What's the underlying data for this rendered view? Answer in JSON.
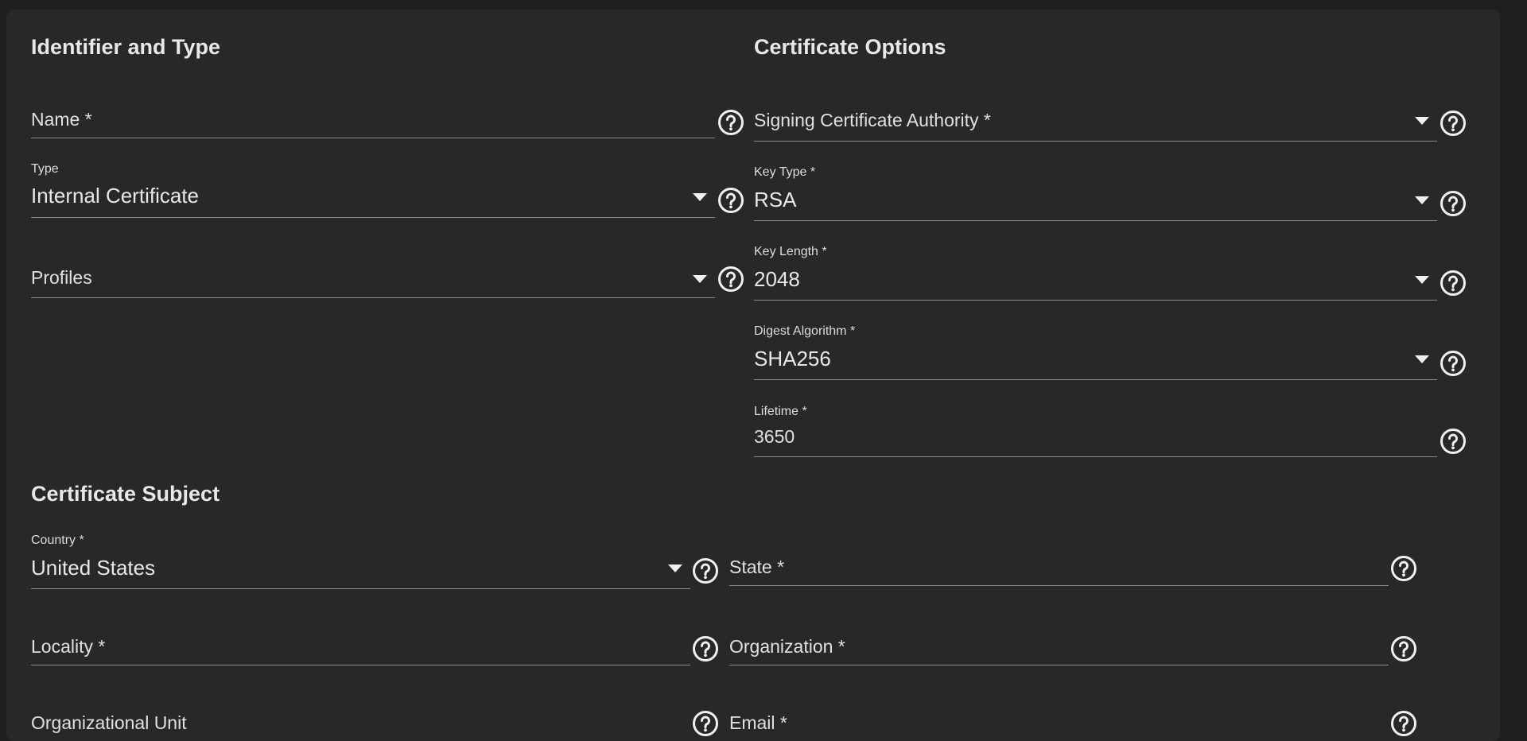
{
  "sections": {
    "identifier": "Identifier and Type",
    "options": "Certificate Options",
    "subject": "Certificate Subject"
  },
  "fields": {
    "name": {
      "placeholder": "Name *"
    },
    "type": {
      "label": "Type",
      "value": "Internal Certificate"
    },
    "profiles": {
      "placeholder": "Profiles"
    },
    "signing_ca": {
      "placeholder": "Signing Certificate Authority *"
    },
    "key_type": {
      "label": "Key Type *",
      "value": "RSA"
    },
    "key_length": {
      "label": "Key Length *",
      "value": "2048"
    },
    "digest": {
      "label": "Digest Algorithm *",
      "value": "SHA256"
    },
    "lifetime": {
      "label": "Lifetime *",
      "value": "3650"
    },
    "country": {
      "label": "Country *",
      "value": "United States"
    },
    "state": {
      "placeholder": "State *"
    },
    "locality": {
      "placeholder": "Locality *"
    },
    "organization": {
      "placeholder": "Organization *"
    },
    "org_unit": {
      "placeholder": "Organizational Unit"
    },
    "email": {
      "placeholder": "Email *"
    }
  },
  "icons": {
    "help": "help-circle-icon",
    "dropdown": "caret-down-icon"
  },
  "colors": {
    "background": "#1e1e1e",
    "card": "#282828",
    "text": "#e8e8e8",
    "underline": "#8a8a8a"
  }
}
